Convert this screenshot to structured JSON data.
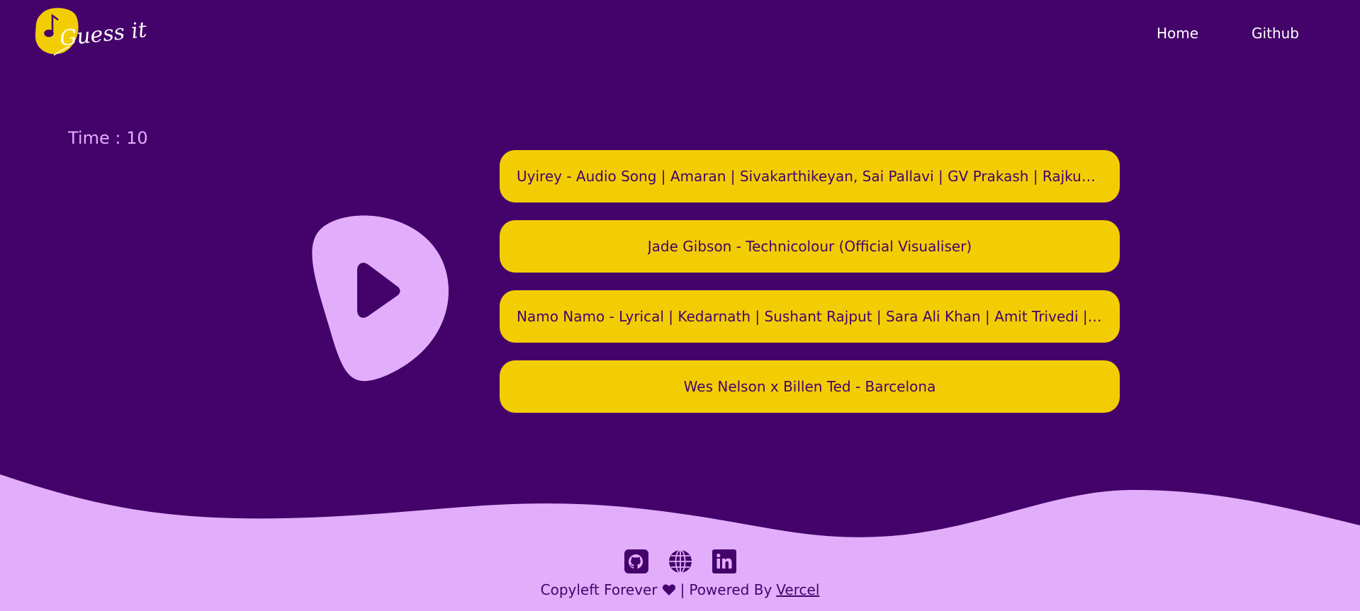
{
  "header": {
    "logo_text": "Guess it",
    "nav": [
      {
        "label": "Home"
      },
      {
        "label": "Github"
      }
    ]
  },
  "game": {
    "timer_label": "Time : 10",
    "options": [
      {
        "label": "Uyirey - Audio Song | Amaran | Sivakarthikeyan, Sai Pallavi | GV Prakash | Rajkumar | Periasamy"
      },
      {
        "label": "Jade Gibson - Technicolour (Official Visualiser)"
      },
      {
        "label": "Namo Namo - Lyrical | Kedarnath | Sushant Rajput | Sara Ali Khan | Amit Trivedi | Amitabh B"
      },
      {
        "label": "Wes Nelson x Billen Ted - Barcelona"
      }
    ]
  },
  "footer": {
    "copyleft": "Copyleft Forever",
    "separator": "|",
    "powered_by": "Powered By",
    "vercel_link": "Vercel"
  },
  "colors": {
    "background": "#44036a",
    "accent_yellow": "#f3cd04",
    "light_purple": "#e2aefc",
    "white": "#ffffff"
  },
  "icons": [
    "music-note-icon",
    "play-icon",
    "github-icon",
    "globe-icon",
    "linkedin-icon",
    "heart-icon"
  ]
}
